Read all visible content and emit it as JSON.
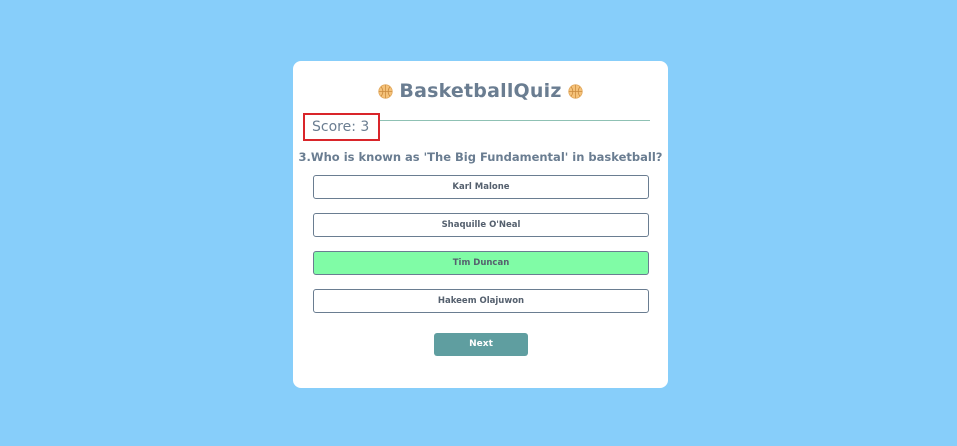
{
  "quiz": {
    "title": "BasketballQuiz",
    "title_icon": "basketball-icon",
    "score_text": "Score: 3",
    "question": "3.Who is known as 'The Big Fundamental' in basketball?",
    "options": [
      {
        "label": "Karl Malone",
        "state": "default"
      },
      {
        "label": "Shaquille O'Neal",
        "state": "default"
      },
      {
        "label": "Tim Duncan",
        "state": "correct"
      },
      {
        "label": "Hakeem Olajuwon",
        "state": "default"
      }
    ],
    "next_label": "Next"
  },
  "colors": {
    "page_background": "#87cefa",
    "card_background": "#ffffff",
    "text": "#6a7d91",
    "correct_option": "#80fca6",
    "next_button": "#5f9ea0",
    "score_highlight_border": "#d9252a"
  }
}
